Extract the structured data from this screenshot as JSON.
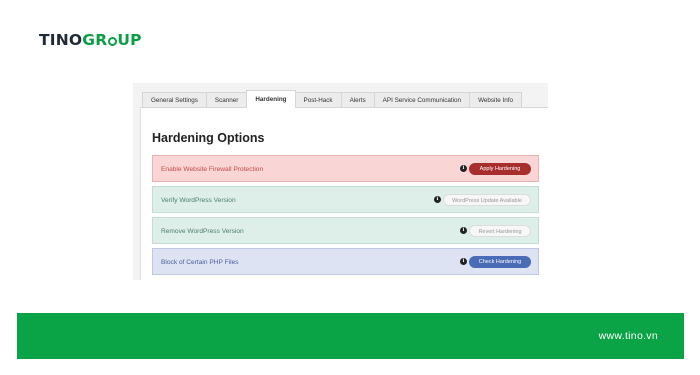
{
  "brand": {
    "name_part1": "TINO",
    "name_part2_a": "GR",
    "name_part2_b": "UP",
    "accent_color": "#0a9e45"
  },
  "tabs": [
    {
      "label": "General Settings",
      "active": false
    },
    {
      "label": "Scanner",
      "active": false
    },
    {
      "label": "Hardening",
      "active": true
    },
    {
      "label": "Post-Hack",
      "active": false
    },
    {
      "label": "Alerts",
      "active": false
    },
    {
      "label": "API Service Communication",
      "active": false
    },
    {
      "label": "Website Info",
      "active": false
    }
  ],
  "panel": {
    "title": "Hardening Options",
    "options": [
      {
        "label": "Enable Website Firewall Protection",
        "button": "Apply Hardening",
        "info_icon": "info-icon",
        "color": "#a82e2e"
      },
      {
        "label": "Verify WordPress Version",
        "button": "WordPress Update Available",
        "info_icon": "info-icon",
        "color": "#f7f7f7"
      },
      {
        "label": "Remove WordPress Version",
        "button": "Revert Hardening",
        "info_icon": "info-icon",
        "color": "#f7f7f7"
      },
      {
        "label": "Block of Certain PHP Files",
        "button": "Check Hardening",
        "info_icon": "info-icon",
        "color": "#4a6bb5"
      }
    ]
  },
  "footer": {
    "website": "www.tino.vn",
    "color": "#0aa345"
  }
}
